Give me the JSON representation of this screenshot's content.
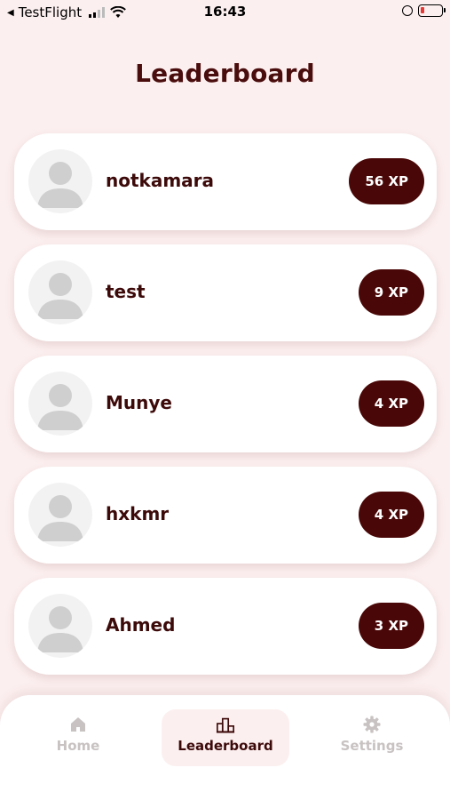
{
  "status_bar": {
    "back_app": "TestFlight",
    "time": "16:43"
  },
  "header": {
    "title": "Leaderboard"
  },
  "leaderboard": [
    {
      "name": "notkamara",
      "xp": "56 XP"
    },
    {
      "name": "test",
      "xp": "9 XP"
    },
    {
      "name": "Munye",
      "xp": "4 XP"
    },
    {
      "name": "hxkmr",
      "xp": "4 XP"
    },
    {
      "name": "Ahmed",
      "xp": "3 XP"
    }
  ],
  "nav": {
    "home": "Home",
    "leaderboard": "Leaderboard",
    "settings": "Settings",
    "active": "leaderboard"
  },
  "colors": {
    "background": "#fcefef",
    "accent": "#4a0707",
    "title": "#4a0d0d",
    "inactive_nav": "#c8c2c2"
  }
}
